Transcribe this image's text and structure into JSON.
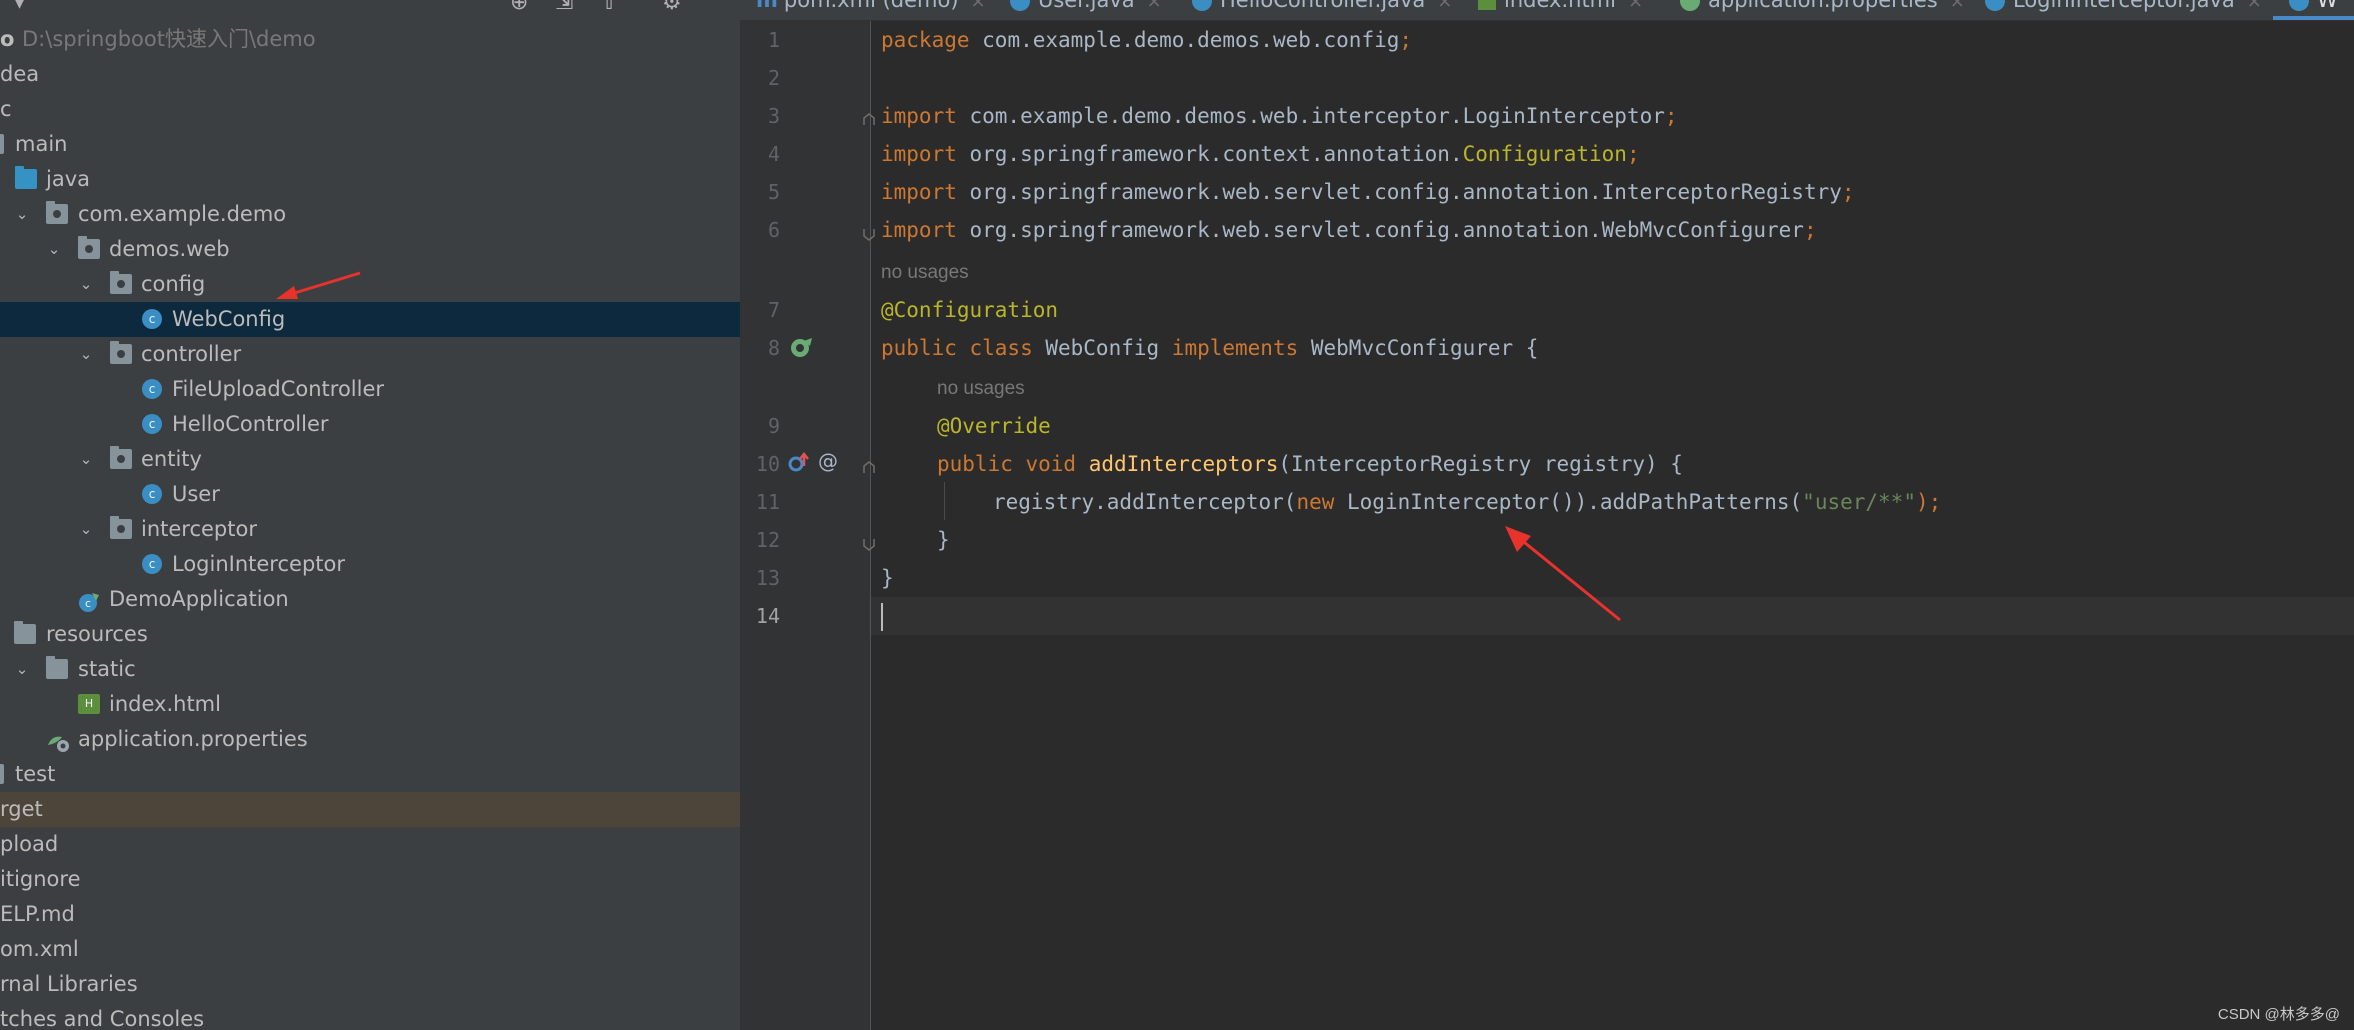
{
  "project": {
    "root_name": "o",
    "root_path": "D:\\springboot快速入门\\demo",
    "items": [
      {
        "label": "dea"
      },
      {
        "label": "c"
      },
      {
        "label": "main"
      },
      {
        "label": "java"
      },
      {
        "label": "com.example.demo"
      },
      {
        "label": "demos.web"
      },
      {
        "label": "config"
      },
      {
        "label": "WebConfig"
      },
      {
        "label": "controller"
      },
      {
        "label": "FileUploadController"
      },
      {
        "label": "HelloController"
      },
      {
        "label": "entity"
      },
      {
        "label": "User"
      },
      {
        "label": "interceptor"
      },
      {
        "label": "LoginInterceptor"
      },
      {
        "label": "DemoApplication"
      },
      {
        "label": "resources"
      },
      {
        "label": "static"
      },
      {
        "label": "index.html"
      },
      {
        "label": "application.properties"
      },
      {
        "label": "test"
      },
      {
        "label": "rget"
      },
      {
        "label": "pload"
      },
      {
        "label": "itignore"
      },
      {
        "label": "ELP.md"
      },
      {
        "label": "om.xml"
      },
      {
        "label": "rnal Libraries"
      },
      {
        "label": "tches and Consoles"
      }
    ]
  },
  "tabs": [
    {
      "label": "pom.xml (demo)"
    },
    {
      "label": "User.java"
    },
    {
      "label": "HelloController.java"
    },
    {
      "label": "index.html"
    },
    {
      "label": "application.properties"
    },
    {
      "label": "LoginInterceptor.java"
    },
    {
      "label": "W"
    }
  ],
  "editor": {
    "line_numbers": [
      "1",
      "2",
      "3",
      "4",
      "5",
      "6",
      "7",
      "8",
      "9",
      "10",
      "11",
      "12",
      "13",
      "14"
    ],
    "no_usages_hint": "no usages",
    "lines": {
      "l1": {
        "kw": "package",
        "rest": " com.example.demo.demos.web.config",
        "semi": ";"
      },
      "l3": {
        "kw": "import",
        "rest": " com.example.demo.demos.web.interceptor.LoginInterceptor",
        "semi": ";"
      },
      "l4": {
        "kw": "import",
        "rest": " org.springframework.context.annotation.",
        "ann": "Configuration",
        "semi": ";"
      },
      "l5": {
        "kw": "import",
        "rest": " org.springframework.web.servlet.config.annotation.InterceptorRegistry",
        "semi": ";"
      },
      "l6": {
        "kw": "import",
        "rest": " org.springframework.web.servlet.config.annotation.WebMvcConfigurer",
        "semi": ";"
      },
      "l7": {
        "ann": "@Configuration"
      },
      "l8": {
        "kw1": "public class",
        "name": " WebConfig ",
        "kw2": "implements",
        "rest": " WebMvcConfigurer {"
      },
      "l9": {
        "ann": "@Override"
      },
      "l10": {
        "kw": "public void",
        "fn": " addInterceptors",
        "rest": "(InterceptorRegistry registry) {"
      },
      "l11": {
        "pre": "registry.addInterceptor(",
        "kw": "new",
        "mid": " LoginInterceptor()).addPathPatterns(",
        "str": "\"user/**\"",
        "post": ");"
      },
      "l12": {
        "text": "}"
      },
      "l13": {
        "text": "}"
      }
    }
  },
  "watermark": "CSDN @林多多@",
  "colors": {
    "keyword": "#cc7832",
    "annotation": "#bbb529",
    "function": "#ffc66d",
    "string": "#6a8759",
    "arrow": "#e8322c"
  }
}
